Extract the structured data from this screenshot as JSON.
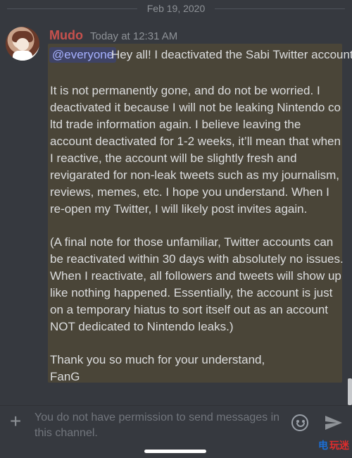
{
  "date_divider": {
    "text": "Feb 19, 2020"
  },
  "message": {
    "author": "Mudo",
    "timestamp": "Today at 12:31 AM",
    "mention": "@everyone",
    "first_line": "Hey all! I deactivated the Sabi Twitter account.",
    "paragraphs": [
      "It is not permanently gone, and do not be worried. I deactivated it because I will not be leaking Nintendo co ltd trade information again. I believe leaving the account deactivated for 1-2 weeks, it’ll mean that when I reactive, the account will be slightly fresh and revigarated for non-leak tweets such as my journalism, reviews, memes, etc. I hope you understand. When I re-open my Twitter, I will likely post invites again.",
      "(A final note for those unfamiliar, Twitter accounts can be reactivated within 30 days with absolutely no issues. When I reactivate, all followers and tweets will show up like nothing happened. Essentially, the account is just on a temporary hiatus to sort itself out as an account NOT dedicated to Nintendo leaks.)",
      "Thank you so much for your understand,\nFanG"
    ]
  },
  "input": {
    "placeholder": "You do not have permission to send messages in this channel."
  },
  "watermark": {
    "text_a": "电",
    "text_b": "玩迷"
  },
  "icons": {
    "add": "plus-icon",
    "emoji": "emoji-icon",
    "send": "send-icon"
  }
}
